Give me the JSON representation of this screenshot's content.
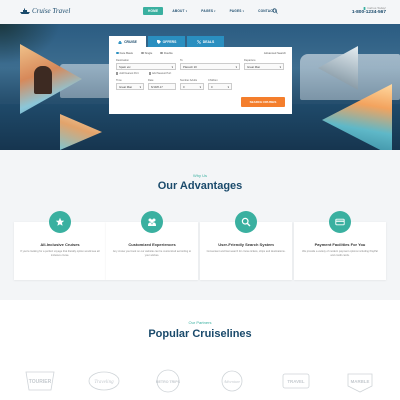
{
  "header": {
    "logo_text": "Cruise Travel",
    "nav": [
      {
        "label": "HOME",
        "active": true,
        "caret": false
      },
      {
        "label": "ABOUT",
        "active": false,
        "caret": true
      },
      {
        "label": "PAGES",
        "active": false,
        "caret": true
      },
      {
        "label": "PAGES",
        "active": false,
        "caret": true
      },
      {
        "label": "CONTACTS",
        "active": false,
        "caret": false
      }
    ],
    "call_label": "Call us Today!",
    "phone": "1-800-1234-567"
  },
  "booking": {
    "tabs": [
      {
        "label": "CRUISE",
        "icon": "ship-icon"
      },
      {
        "label": "OFFERS",
        "icon": "tag-icon"
      },
      {
        "label": "DEALS",
        "icon": "percent-icon"
      }
    ],
    "radios": [
      "Fare Basis",
      "Single",
      "Double"
    ],
    "advanced": "Advanced Search",
    "destination_label": "Destination",
    "destination_value": "Spain etc",
    "to_label": "To",
    "to_value": "Placesh 20",
    "departure_label": "Departure",
    "departure_value": "Great Man",
    "checks": [
      "Add Nearest Port",
      "Add Nearest Port"
    ],
    "row3": [
      {
        "label": "Time",
        "value": "Great Man"
      },
      {
        "label": "Date",
        "value": "6/19/8-17"
      },
      {
        "label": "Number Adults",
        "value": "0"
      },
      {
        "label": "Children",
        "value": "0"
      }
    ],
    "search_button": "SEARCH CRUISES"
  },
  "advantages": {
    "eyebrow": "Why Us",
    "title": "Our Advantages",
    "cards": [
      {
        "title": "All-Inclusive Cruises",
        "desc": "If you're looking for a perfect voyage that literally option would see all inclusive cruise.",
        "icon": "star-icon"
      },
      {
        "title": "Customized Experiences",
        "desc": "Any cruise you book on our website can be customized according to your wishes.",
        "icon": "people-icon"
      },
      {
        "title": "User-Friendly Search System",
        "desc": "Convenient and fast search for cruise tickets, ships and destinations.",
        "icon": "search-icon"
      },
      {
        "title": "Payment Facilities For You",
        "desc": "We provide a variety of modern payment options including PayPal and credit cards.",
        "icon": "credit-card-icon"
      }
    ]
  },
  "cruiselines": {
    "eyebrow": "Our Partners",
    "title": "Popular Cruiselines",
    "brands": [
      "TOURIER",
      "Traveling",
      "RETRO TRIPS",
      "Adventure",
      "TRAVEL",
      "MARBLE"
    ]
  },
  "colors": {
    "accent": "#3ab0a0",
    "navy": "#1a4a6b",
    "button": "#f47e2c",
    "tab": "#2a8fc0"
  }
}
